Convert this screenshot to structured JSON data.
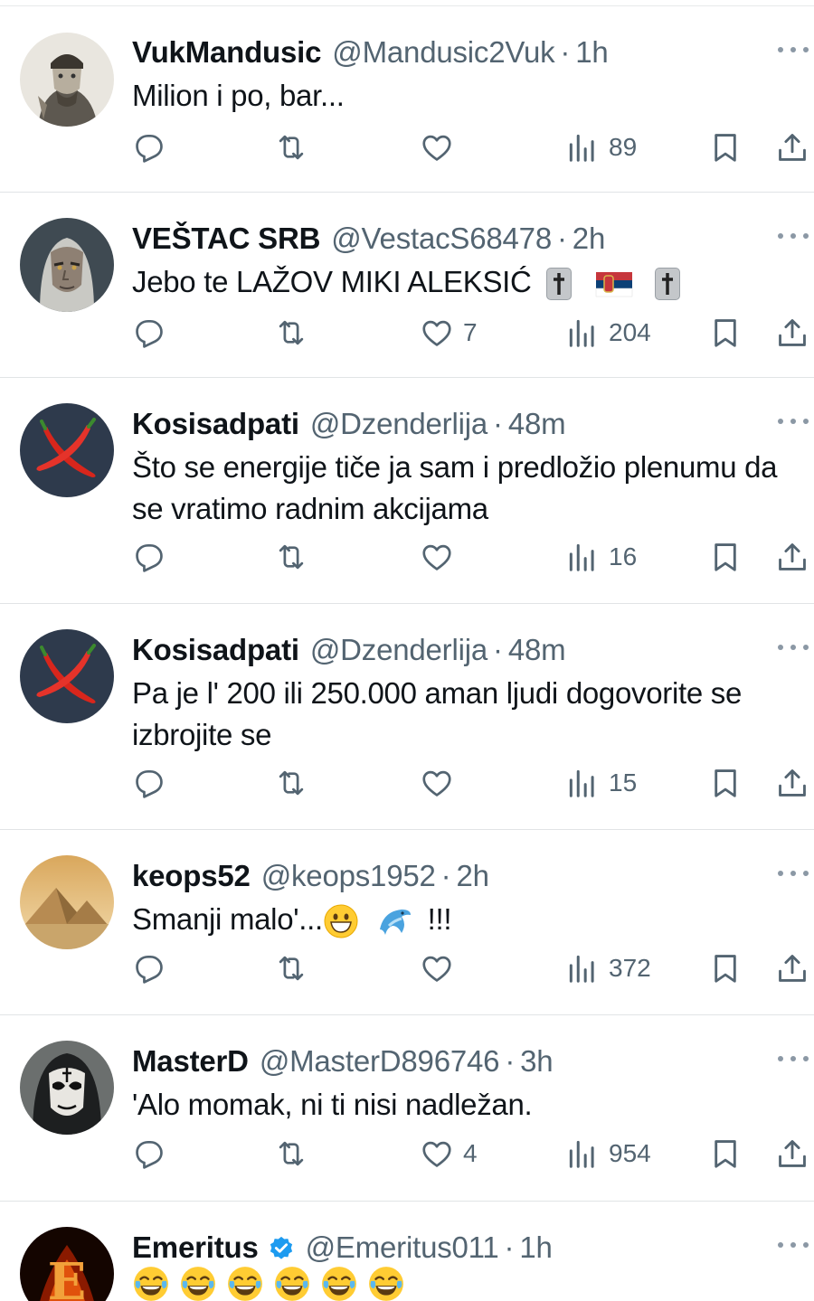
{
  "tweets": [
    {
      "name": "VukMandusic",
      "handle": "@Mandusic2Vuk",
      "sep": "·",
      "time": "1h",
      "text": "Milion i po, bar...",
      "likes": "",
      "views": "89",
      "verified": false,
      "avatar_icon": "portrait-avatar-icon"
    },
    {
      "name": "VEŠTAC SRB",
      "handle": "@VestacS68478",
      "sep": "·",
      "time": "2h",
      "text": "Jebo te LAŽOV MIKI ALEKSIĆ",
      "likes": "7",
      "views": "204",
      "verified": false,
      "avatar_icon": "witcher-avatar-icon"
    },
    {
      "name": "Kosisadpati",
      "handle": "@Dzenderlija",
      "sep": "·",
      "time": "48m",
      "text": "Što se energije tiče ja sam i predložio plenumu da se vratimo radnim akcijama",
      "likes": "",
      "views": "16",
      "verified": false,
      "avatar_icon": "chili-peppers-avatar-icon"
    },
    {
      "name": "Kosisadpati",
      "handle": "@Dzenderlija",
      "sep": "·",
      "time": "48m",
      "text": "Pa je l' 200 ili 250.000 aman ljudi dogovorite se izbrojite se",
      "likes": "",
      "views": "15",
      "verified": false,
      "avatar_icon": "chili-peppers-avatar-icon"
    },
    {
      "name": "keops52",
      "handle": "@keops1952",
      "sep": "·",
      "time": "2h",
      "text": "Smanji malo'...",
      "text_suffix": "!!!",
      "likes": "",
      "views": "372",
      "verified": false,
      "avatar_icon": "pyramids-avatar-icon"
    },
    {
      "name": "MasterD",
      "handle": "@MasterD896746",
      "sep": "·",
      "time": "3h",
      "text": "'Alo momak, ni ti nisi nadležan.",
      "likes": "4",
      "views": "954",
      "verified": false,
      "avatar_icon": "mask-avatar-icon"
    },
    {
      "name": "Emeritus",
      "handle": "@Emeritus011",
      "sep": "·",
      "time": "1h",
      "text": "",
      "likes": "",
      "views": "",
      "verified": true,
      "avatar_icon": "fire-letter-e-avatar-icon"
    }
  ],
  "emoji": {
    "cross": "cross-box-emoji",
    "flag": "serbia-flag-emoji",
    "grin": "grinning-face-emoji",
    "dolphin": "dolphin-emoji",
    "laugh": "tears-of-joy-emoji"
  },
  "colors": {
    "text": "#0f1419",
    "secondary": "#536471",
    "divider": "#e1e4e6",
    "verified": "#1d9bf0"
  },
  "avatar_initials": {
    "emeritus": "E"
  }
}
